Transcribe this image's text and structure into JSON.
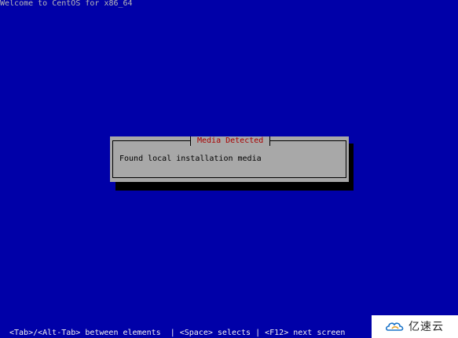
{
  "header": {
    "title": "Welcome to CentOS for x86_64"
  },
  "dialog": {
    "title": "Media Detected",
    "message": "Found local installation media"
  },
  "footer": {
    "help": "<Tab>/<Alt-Tab> between elements  | <Space> selects | <F12> next screen"
  },
  "watermark": {
    "icon": "cloud-logo-icon",
    "text": "亿速云"
  },
  "colors": {
    "background": "#0000a8",
    "dialog": "#a8a8a8",
    "dialog_title": "#a80000",
    "shadow": "#000000"
  }
}
